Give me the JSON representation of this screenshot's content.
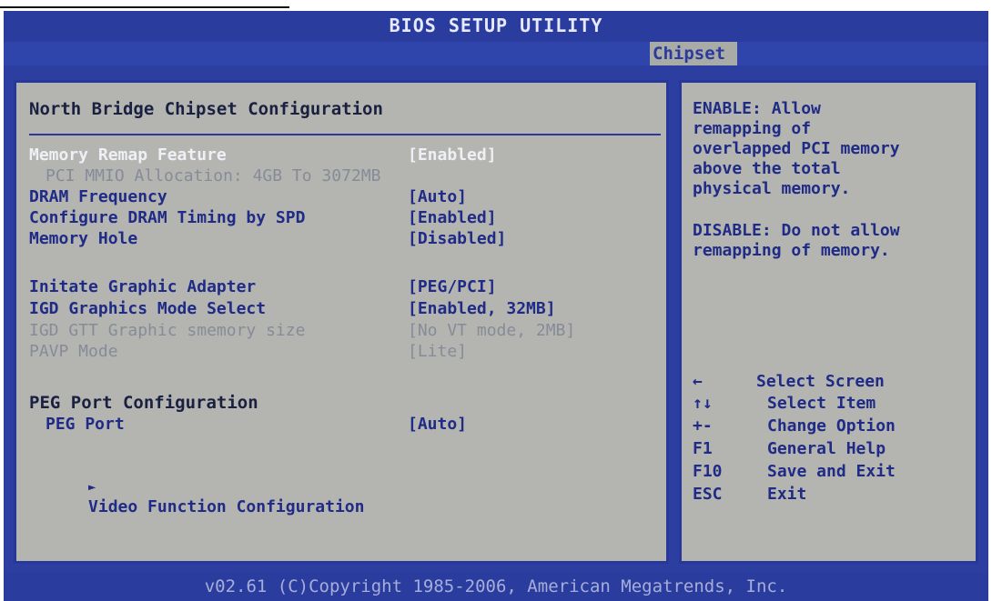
{
  "window": {
    "title": "BIOS SETUP UTILITY"
  },
  "tabs": [
    {
      "label": "Chipset",
      "active": true
    }
  ],
  "main": {
    "section_title": "North Bridge Chipset Configuration",
    "settings": [
      {
        "label": "Memory Remap Feature",
        "value": "[Enabled]",
        "state": "selected"
      },
      {
        "label": "PCI MMIO Allocation: 4GB To 3072MB",
        "value": "",
        "state": "info"
      },
      {
        "label": "DRAM Frequency",
        "value": "[Auto]",
        "state": "editable"
      },
      {
        "label": "Configure DRAM Timing by SPD",
        "value": "[Enabled]",
        "state": "editable"
      },
      {
        "label": "Memory Hole",
        "value": "[Disabled]",
        "state": "editable"
      },
      {
        "label": "Initate Graphic Adapter",
        "value": "[PEG/PCI]",
        "state": "editable"
      },
      {
        "label": "IGD Graphics Mode Select",
        "value": "[Enabled, 32MB]",
        "state": "editable"
      },
      {
        "label": "IGD GTT Graphic smemory size",
        "value": "[No VT mode, 2MB]",
        "state": "disabled"
      },
      {
        "label": "PAVP Mode",
        "value": "[Lite]",
        "state": "disabled"
      }
    ],
    "peg": {
      "header": "PEG Port Configuration",
      "port_label": "PEG Port",
      "port_value": "[Auto]"
    },
    "submenu": {
      "arrow": "►",
      "label": "Video Function Configuration"
    }
  },
  "help": {
    "lines": [
      "ENABLE: Allow",
      "remapping of",
      "overlapped PCI memory",
      "above the total",
      "physical memory.",
      "",
      "DISABLE: Do not allow",
      "remapping of memory."
    ],
    "keys": [
      {
        "key": "←",
        "desc": "Select Screen"
      },
      {
        "key": "↑↓",
        "desc": "Select Item"
      },
      {
        "key": "+-",
        "desc": "Change Option"
      },
      {
        "key": "F1",
        "desc": "General Help"
      },
      {
        "key": "F10",
        "desc": "Save and Exit"
      },
      {
        "key": "ESC",
        "desc": "Exit"
      }
    ]
  },
  "footer": {
    "text": "v02.61 (C)Copyright 1985-2006, American Megatrends, Inc."
  },
  "colors": {
    "frame": "#2c3fa0",
    "panel": "#b4b5b0",
    "text_navy": "#1f2b86",
    "text_selected": "#eef0f6",
    "text_disabled": "#868b99"
  }
}
